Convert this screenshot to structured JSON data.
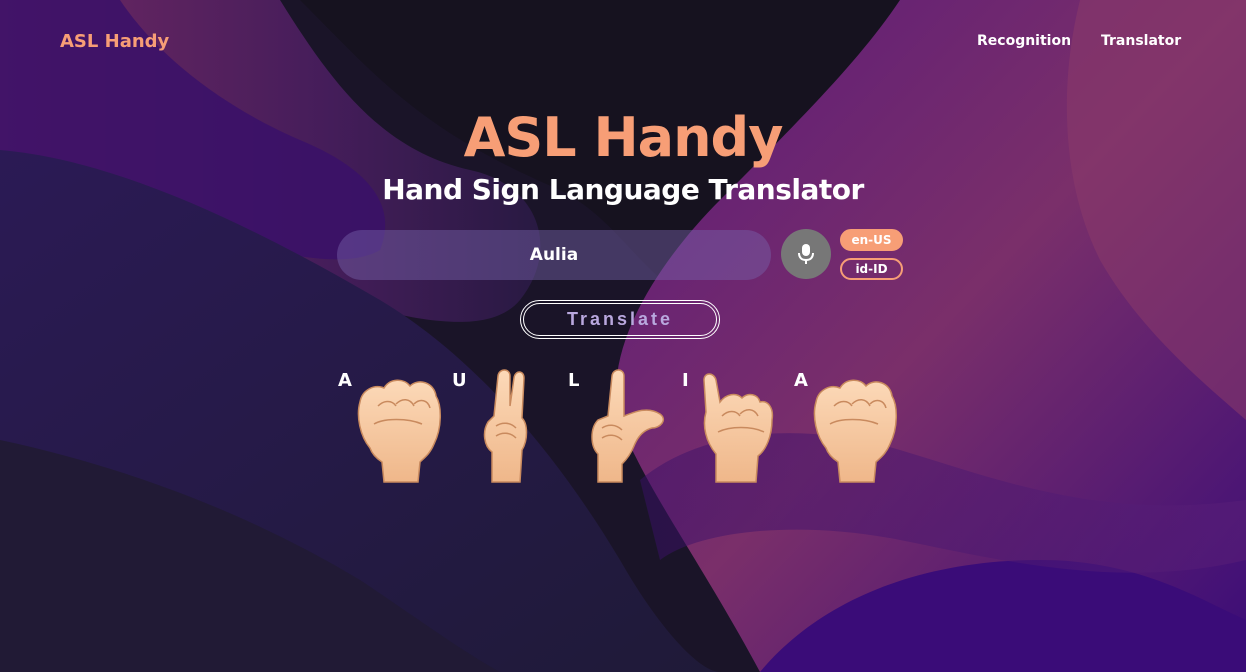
{
  "nav": {
    "logo": "ASL Handy",
    "links": [
      "Recognition",
      "Translator"
    ]
  },
  "hero": {
    "title": "ASL Handy",
    "subtitle": "Hand Sign Language Translator"
  },
  "input": {
    "value": "Aulia"
  },
  "mic_icon": "microphone-icon",
  "languages": [
    "en-US",
    "id-ID"
  ],
  "translate_label": "Translate",
  "signs": [
    {
      "letter": "A",
      "icon": "asl-a-hand-icon"
    },
    {
      "letter": "U",
      "icon": "asl-u-hand-icon"
    },
    {
      "letter": "L",
      "icon": "asl-l-hand-icon"
    },
    {
      "letter": "I",
      "icon": "asl-i-hand-icon"
    },
    {
      "letter": "A",
      "icon": "asl-a-hand-icon"
    }
  ],
  "colors": {
    "accent": "#f79e76",
    "background": "#1e1730",
    "purple": "#3d0f6e",
    "mic": "#777777"
  }
}
